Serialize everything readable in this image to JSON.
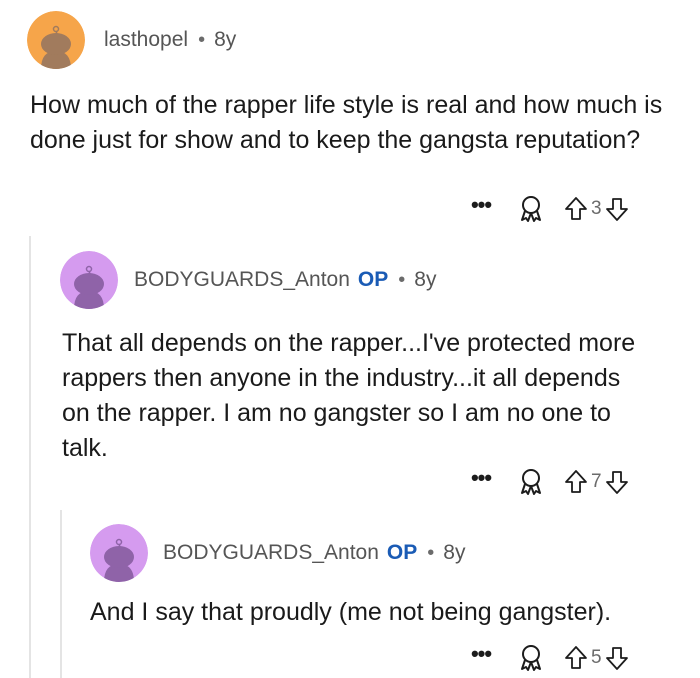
{
  "comments": [
    {
      "username": "lasthopel",
      "age": "8y",
      "text": "How much of the rapper life style is real and how much is done just for show and to keep the gangsta reputation?",
      "votes": "3",
      "avatar_color": "#f6a54a"
    },
    {
      "username": "BODYGUARDS_Anton",
      "op_label": "OP",
      "age": "8y",
      "text": "That all depends on the rapper...I've protected more rappers then anyone in the industry...it all depends on the rapper.  I am no gangster so I am no one to talk.",
      "votes": "7",
      "avatar_color": "#d59bef"
    },
    {
      "username": "BODYGUARDS_Anton",
      "op_label": "OP",
      "age": "8y",
      "text": "And I say that proudly (me not being gangster).",
      "votes": "5",
      "avatar_color": "#d59bef"
    }
  ],
  "ui": {
    "separator": "•",
    "more_label": "•••"
  },
  "colors": {
    "op_badge": "#1a5bb5",
    "thread_line": "#e4e4e4",
    "meta_text": "#555555"
  }
}
